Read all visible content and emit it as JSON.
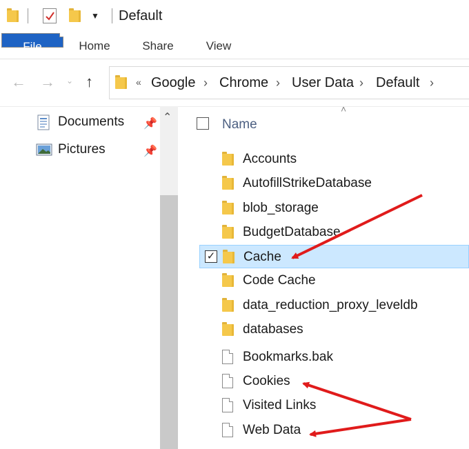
{
  "window": {
    "title": "Default"
  },
  "ribbon": {
    "tabs": [
      "File",
      "Home",
      "Share",
      "View"
    ]
  },
  "address": {
    "overflow": "«",
    "crumbs": [
      "Google",
      "Chrome",
      "User Data",
      "Default"
    ]
  },
  "nav_pane": {
    "items": [
      {
        "label": "Documents",
        "icon": "documents-icon"
      },
      {
        "label": "Pictures",
        "icon": "pictures-icon"
      }
    ]
  },
  "content": {
    "header": {
      "name": "Name"
    },
    "items": [
      {
        "name": "Accounts",
        "type": "folder",
        "selected": false
      },
      {
        "name": "AutofillStrikeDatabase",
        "type": "folder",
        "selected": false
      },
      {
        "name": "blob_storage",
        "type": "folder",
        "selected": false
      },
      {
        "name": "BudgetDatabase",
        "type": "folder",
        "selected": false
      },
      {
        "name": "Cache",
        "type": "folder",
        "selected": true
      },
      {
        "name": "Code Cache",
        "type": "folder",
        "selected": false
      },
      {
        "name": "data_reduction_proxy_leveldb",
        "type": "folder",
        "selected": false
      },
      {
        "name": "databases",
        "type": "folder",
        "selected": false
      },
      {
        "name": "Bookmarks.bak",
        "type": "file",
        "selected": false
      },
      {
        "name": "Cookies",
        "type": "file",
        "selected": false
      },
      {
        "name": "Visited Links",
        "type": "file",
        "selected": false
      },
      {
        "name": "Web Data",
        "type": "file",
        "selected": false
      }
    ]
  },
  "colors": {
    "file_tab": "#1e63c4",
    "selection_bg": "#cce8ff",
    "arrow": "#e01b1b"
  }
}
